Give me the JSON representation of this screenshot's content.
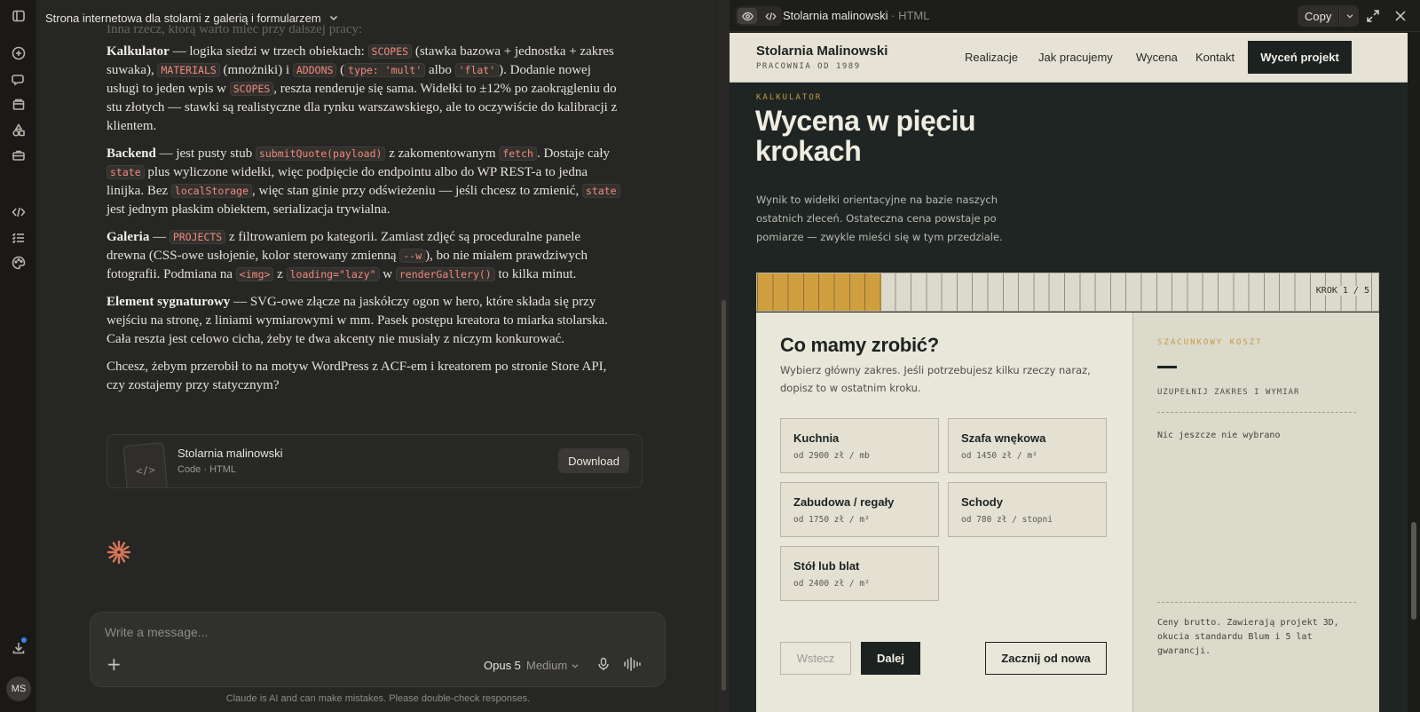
{
  "chat": {
    "title": "Strona internetowa dla stolarni z galerią i formularzem",
    "faded_line": "Inna rzecz, którą warto mieć przy dalszej pracy:",
    "paragraphs": [
      {
        "lead": "Kalkulator",
        "parts": [
          {
            "t": " — logika siedzi w trzech obiektach: "
          },
          {
            "c": "SCOPES"
          },
          {
            "t": " (stawka bazowa + jednostka + zakres suwaka), "
          },
          {
            "c": "MATERIALS"
          },
          {
            "t": " (mnożniki) i "
          },
          {
            "c": "ADDONS"
          },
          {
            "t": " ("
          },
          {
            "c": "type: 'mult'"
          },
          {
            "t": " albo "
          },
          {
            "c": "'flat'"
          },
          {
            "t": "). Dodanie nowej usługi to jeden wpis w "
          },
          {
            "c": "SCOPES"
          },
          {
            "t": ", reszta renderuje się sama. Widełki to ±12% po zaokrągleniu do stu złotych — stawki są realistyczne dla rynku warszawskiego, ale to oczywiście do kalibracji z klientem."
          }
        ]
      },
      {
        "lead": "Backend",
        "parts": [
          {
            "t": " — jest pusty stub "
          },
          {
            "c": "submitQuote(payload)"
          },
          {
            "t": " z zakomentowanym "
          },
          {
            "c": "fetch"
          },
          {
            "t": ". Dostaje cały "
          },
          {
            "c": "state"
          },
          {
            "t": " plus wyliczone widełki, więc podpięcie do endpointu albo do WP REST-a to jedna linijka. Bez "
          },
          {
            "c": "localStorage"
          },
          {
            "t": ", więc stan ginie przy odświeżeniu — jeśli chcesz to zmienić, "
          },
          {
            "c": "state"
          },
          {
            "t": " jest jednym płaskim obiektem, serializacja trywialna."
          }
        ]
      },
      {
        "lead": "Galeria",
        "parts": [
          {
            "t": " — "
          },
          {
            "c": "PROJECTS"
          },
          {
            "t": " z filtrowaniem po kategorii. Zamiast zdjęć są proceduralne panele drewna (CSS-owe usłojenie, kolor sterowany zmienną "
          },
          {
            "c": "--w"
          },
          {
            "t": "), bo nie miałem prawdziwych fotografii. Podmiana na "
          },
          {
            "c": "<img>"
          },
          {
            "t": " z "
          },
          {
            "c": "loading=\"lazy\""
          },
          {
            "t": " w "
          },
          {
            "c": "renderGallery()"
          },
          {
            "t": " to kilka minut."
          }
        ]
      },
      {
        "lead": "Element sygnaturowy",
        "parts": [
          {
            "t": " — SVG-owe złącze na jaskółczy ogon w hero, które składa się przy wejściu na stronę, z liniami wymiarowymi w mm. Pasek postępu kreatora to miarka stolarska. Cała reszta jest celowo cicha, żeby te dwa akcenty nie musiały z niczym konkurować."
          }
        ]
      },
      {
        "lead": "",
        "parts": [
          {
            "t": "Chcesz, żebym przerobił to na motyw WordPress z ACF-em i kreatorem po stronie Store API, czy zostajemy przy statycznym?"
          }
        ]
      }
    ],
    "file": {
      "name": "Stolarnia malinowski",
      "meta": "Code · HTML",
      "thumb": "</>",
      "download": "Download"
    },
    "composer": {
      "placeholder": "Write a message...",
      "plus": "+",
      "model": "Opus 5",
      "effort": "Medium"
    },
    "disclaimer": "Claude is AI and can make mistakes. Please double-check responses.",
    "avatar": "MS"
  },
  "artifact": {
    "title": "Stolarnia malinowski",
    "sep": " · ",
    "type": "HTML",
    "copy": "Copy",
    "site": {
      "brand": "Stolarnia Malinowski",
      "brand_sub": "PRACOWNIA OD 1989",
      "nav": [
        "Realizacje",
        "Jak pracujemy",
        "Wycena",
        "Kontakt"
      ],
      "cta": "Wyceń projekt",
      "kicker": "KALKULATOR",
      "title": "Wycena w pięciu krokach",
      "lead": "Wynik to widełki orientacyjne na bazie naszych ostatnich zleceń. Ostateczna cena powstaje po pomiarze — zwykle mieści się w tym przedziale.",
      "step_label": "KROK 1 / 5",
      "step_current": 1,
      "step_total": 5,
      "question": "Co mamy zrobić?",
      "question_desc": "Wybierz główny zakres. Jeśli potrzebujesz kilku rzeczy naraz, dopisz to w ostatnim kroku.",
      "options": [
        {
          "name": "Kuchnia",
          "price": "od 2900 zł / mb"
        },
        {
          "name": "Szafa wnękowa",
          "price": "od 1450 zł / m²"
        },
        {
          "name": "Zabudowa / regały",
          "price": "od 1750 zł / m²"
        },
        {
          "name": "Schody",
          "price": "od 780 zł / stopni"
        },
        {
          "name": "Stół lub blat",
          "price": "od 2400 zł / m²"
        }
      ],
      "back": "Wstecz",
      "next": "Dalej",
      "reset": "Zacznij od nowa",
      "side": {
        "kicker": "SZACUNKOWY KOSZT",
        "value": "—",
        "hint": "UZUPEŁNIJ ZAKRES I WYMIAR",
        "empty": "Nic jeszcze nie wybrano",
        "note": "Ceny brutto. Zawierają projekt 3D, okucia standardu Blum i 5 lat gwarancji."
      }
    }
  },
  "colors": {
    "accent": "#cf9f3f",
    "dark": "#1b2220",
    "paper": "#e9e6da",
    "code": "#f08a7e",
    "spark": "#d97757"
  },
  "icons": [
    "sidebar-toggle-icon",
    "new-chat-icon",
    "chats-icon",
    "projects-icon",
    "artifacts-icon",
    "tools-icon",
    "code-icon",
    "tasks-icon",
    "palette-icon",
    "download-icon",
    "chevron-down-icon",
    "eye-icon",
    "code-view-icon",
    "expand-icon",
    "close-icon",
    "mic-icon",
    "voice-icon",
    "spark-icon"
  ]
}
